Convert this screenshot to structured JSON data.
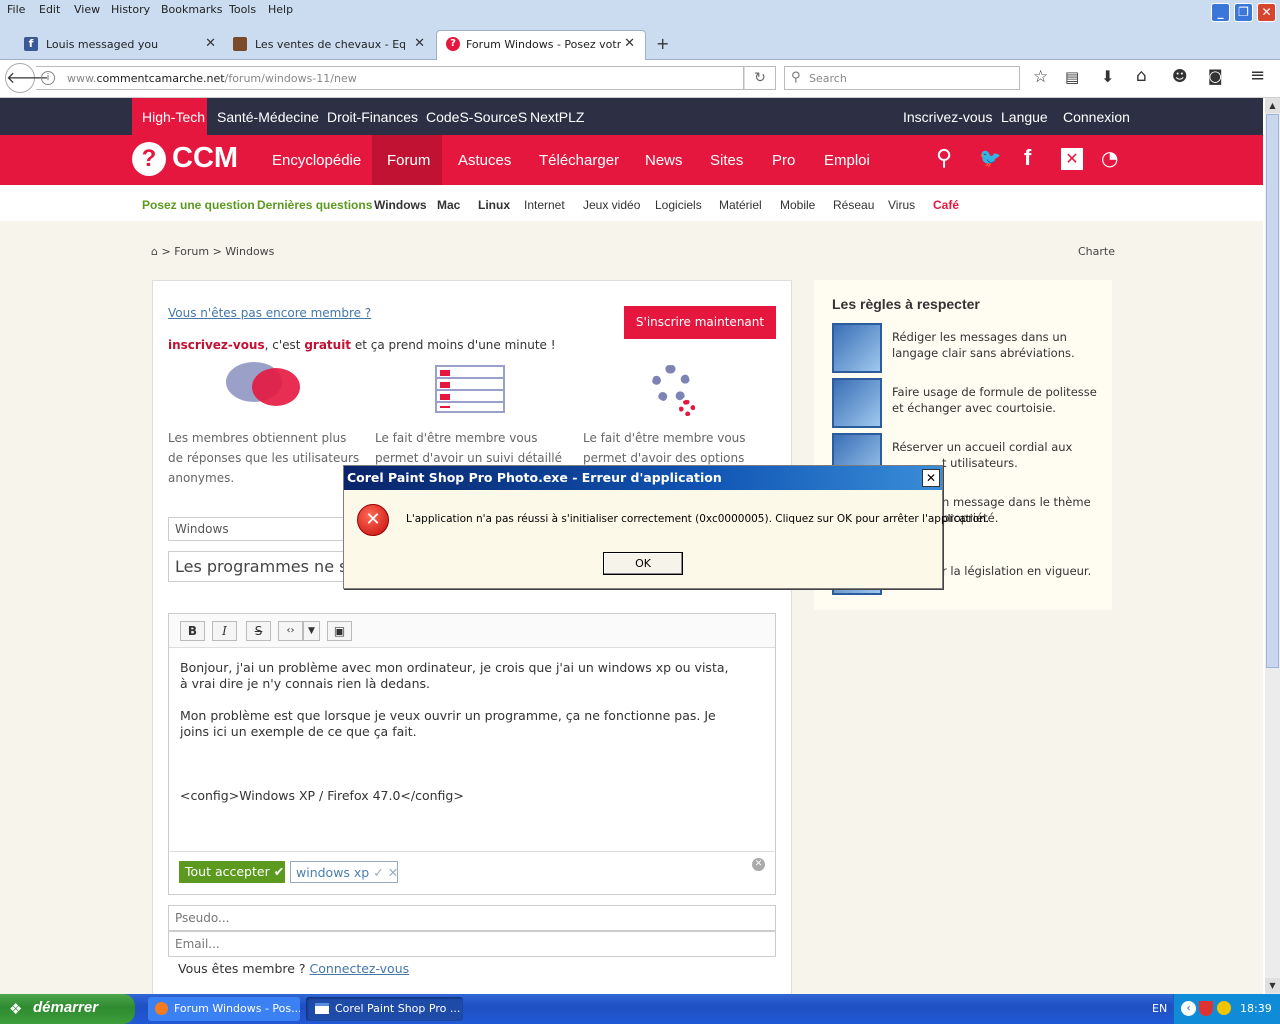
{
  "menubar": {
    "items": [
      "File",
      "Edit",
      "View",
      "History",
      "Bookmarks",
      "Tools",
      "Help"
    ]
  },
  "tabs": [
    {
      "title": "Louis messaged you",
      "color": "#3b5998"
    },
    {
      "title": "Les ventes de chevaux - Equi...",
      "color": "#7a4a2a"
    },
    {
      "title": "Forum Windows - Posez votre...",
      "color": "#e5173f"
    }
  ],
  "urlbar": {
    "url_prefix": "www.",
    "url_domain": "commentcamarche.net",
    "url_path": "/forum/windows-11/new",
    "search_placeholder": "Search"
  },
  "site": {
    "topnav_left": [
      "High-Tech",
      "Santé-Médecine",
      "Droit-Finances",
      "CodeS-SourceS",
      "NextPLZ"
    ],
    "topnav_right": [
      "Inscrivez-vous",
      "Langue",
      "Connexion"
    ],
    "logo": "CCM",
    "mainnav": [
      "Encyclopédie",
      "Forum",
      "Astuces",
      "Télécharger",
      "News",
      "Sites",
      "Pro",
      "Emploi"
    ],
    "subnav": [
      "Posez une question",
      "Dernières questions",
      "Windows",
      "Mac",
      "Linux",
      "Internet",
      "Jeux vidéo",
      "Logiciels",
      "Matériel",
      "Mobile",
      "Réseau",
      "Virus",
      "Café"
    ],
    "breadcrumb": {
      "forum": "Forum",
      "sep": ">",
      "section": "Windows",
      "charte": "Charte"
    }
  },
  "signup": {
    "not_member": "Vous n'êtes pas encore membre ?",
    "cta": "S'inscrire maintenant",
    "line_bold": "inscrivez-vous",
    "line_mid": ", c'est ",
    "line_bold2": "gratuit",
    "line_end": " et ça prend moins d'une minute !",
    "benefits": [
      {
        "l1": "Les membres obtiennent plus",
        "l2": "de réponses que les utilisateurs",
        "l3": "anonymes."
      },
      {
        "l1": "Le fait d'être membre vous",
        "l2": "permet d'avoir un suivi détaillé",
        "l3": ""
      },
      {
        "l1": "Le fait d'être membre vous",
        "l2": "permet d'avoir des options",
        "l3": ""
      }
    ]
  },
  "form": {
    "category": "Windows",
    "title": "Les programmes ne s",
    "toolbar": [
      "B",
      "I",
      "S",
      "‹›",
      "▼",
      "▣"
    ],
    "body": [
      "Bonjour, j'ai un problème avec mon ordinateur, je crois que j'ai un windows xp ou vista,",
      "à vrai dire je n'y connais rien là dedans.",
      "",
      "Mon problème est que lorsque je veux ouvrir un programme, ça ne fonctionne pas. Je",
      "joins ici un exemple de ce que ça fait.",
      "",
      "",
      "",
      "<config>Windows XP / Firefox 47.0</config>"
    ],
    "accept_all": "Tout accepter",
    "tag": "windows xp",
    "pseudo_placeholder": "Pseudo...",
    "email_placeholder": "Email...",
    "already_member": "Vous êtes membre ?",
    "login_link": "Connectez-vous"
  },
  "rules": {
    "title": "Les règles à respecter",
    "items": [
      {
        "l1": "Rédiger les messages dans un",
        "l2": "langage clair sans abréviations."
      },
      {
        "l1": "Faire usage de formule de politesse",
        "l2": "et échanger avec courtoisie."
      },
      {
        "l1": "Réserver un accueil cordial aux",
        "l2": "t utilisateurs."
      },
      {
        "l1": "n message dans le thème",
        "l2": "propriété."
      },
      {
        "l1": "r la législation en vigueur.",
        "l2": ""
      }
    ]
  },
  "dialog": {
    "title": "Corel Paint Shop Pro Photo.exe - Erreur d'application",
    "message": "L'application n'a pas réussi à s'initialiser correctement (0xc0000005). Cliquez sur OK pour arrêter l'application.",
    "ok": "OK"
  },
  "taskbar": {
    "start": "démarrer",
    "tasks": [
      "Forum Windows - Pos...",
      "Corel Paint Shop Pro ..."
    ],
    "lang": "EN",
    "time": "18:39"
  },
  "colors": {
    "ccm_red": "#e5173f",
    "ccm_dark": "#2d2f45",
    "green": "#5b9a1e",
    "xp_blue": "#245edb"
  }
}
